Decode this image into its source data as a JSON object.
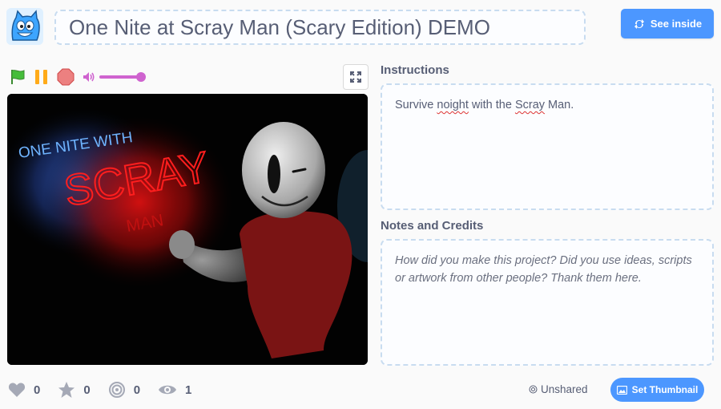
{
  "header": {
    "title": "One Nite at Scray Man (Scary Edition) DEMO",
    "see_inside_label": "See inside"
  },
  "player": {
    "controls": [
      "green-flag-icon",
      "pause-icon",
      "stop-icon",
      "volume-icon"
    ],
    "volume_level": 0.95,
    "stage_text": {
      "line1": "ONE NITE WITH",
      "line2": "SCRAY",
      "line3": "MAN"
    }
  },
  "instructions": {
    "heading": "Instructions",
    "text_before": "Survive ",
    "word1": "noight",
    "text_middle": " with the ",
    "word2": "Scray",
    "text_after": " Man."
  },
  "notes": {
    "heading": "Notes and Credits",
    "placeholder": "How did you make this project? Did you use ideas, scripts or artwork from other people? Thank them here."
  },
  "stats": {
    "loves": "0",
    "favorites": "0",
    "remixes": "0",
    "views": "1"
  },
  "footer": {
    "unshared_label": "Unshared",
    "set_thumbnail_label": "Set Thumbnail"
  },
  "colors": {
    "accent": "#4c97ff",
    "volume": "#cf63cf",
    "flag": "#45bd3a",
    "pause": "#ffab19",
    "stop": "#ec5959"
  }
}
